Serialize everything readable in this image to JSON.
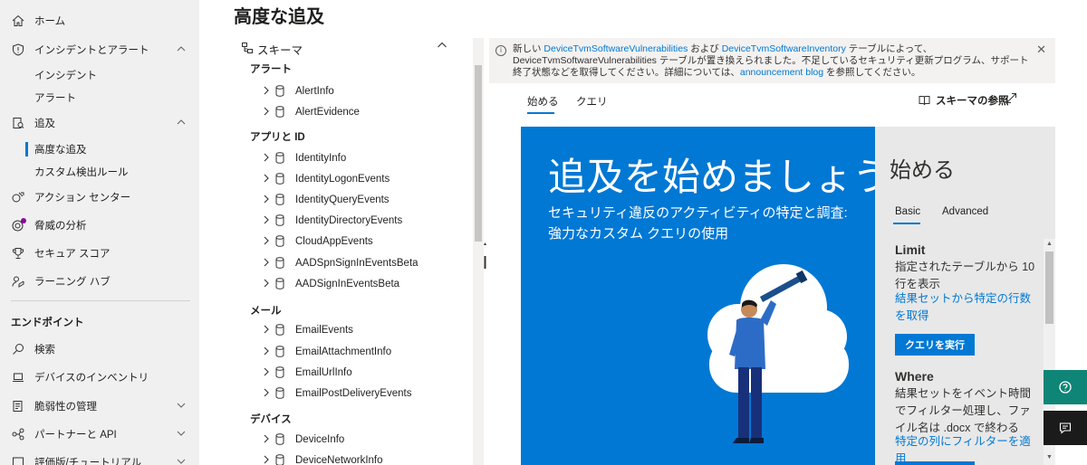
{
  "page": {
    "title": "高度な追及"
  },
  "nav": {
    "items": [
      {
        "label": "ホーム",
        "icon": "home-icon",
        "expanded": null
      },
      {
        "label": "インシデントとアラート",
        "icon": "shield-icon",
        "expanded": true
      },
      {
        "label": "インシデント",
        "sub": true
      },
      {
        "label": "アラート",
        "sub": true
      },
      {
        "label": "追及",
        "icon": "hunting-icon",
        "expanded": true
      },
      {
        "label": "高度な追及",
        "sub": true,
        "active": true
      },
      {
        "label": "カスタム検出ルール",
        "sub": true
      },
      {
        "label": "アクション センター",
        "icon": "action-center-icon"
      },
      {
        "label": "脅威の分析",
        "icon": "threat-analytics-icon"
      },
      {
        "label": "セキュア スコア",
        "icon": "trophy-icon"
      },
      {
        "label": "ラーニング ハブ",
        "icon": "learning-hub-icon"
      }
    ],
    "section_label": "エンドポイント",
    "endpoint_items": [
      {
        "label": "検索",
        "icon": "search-icon"
      },
      {
        "label": "デバイスのインベントリ",
        "icon": "laptop-icon"
      },
      {
        "label": "脆弱性の管理",
        "icon": "vulnerability-icon",
        "expanded": false
      },
      {
        "label": "パートナーと API",
        "icon": "partners-icon",
        "expanded": false
      },
      {
        "label": "評価版/チュートリアル",
        "icon": "tutorial-icon",
        "expanded": false
      }
    ]
  },
  "schema": {
    "title": "スキーマ",
    "groups": [
      {
        "label": "アラート",
        "tables": [
          "AlertInfo",
          "AlertEvidence"
        ]
      },
      {
        "label": "アプリと ID",
        "tables": [
          "IdentityInfo",
          "IdentityLogonEvents",
          "IdentityQueryEvents",
          "IdentityDirectoryEvents",
          "CloudAppEvents",
          "AADSpnSignInEventsBeta",
          "AADSignInEventsBeta"
        ]
      },
      {
        "label": "メール",
        "tables": [
          "EmailEvents",
          "EmailAttachmentInfo",
          "EmailUrlInfo",
          "EmailPostDeliveryEvents"
        ]
      },
      {
        "label": "デバイス",
        "tables": [
          "DeviceInfo",
          "DeviceNetworkInfo"
        ]
      }
    ]
  },
  "info_bar": {
    "t1": "新しい ",
    "link1": "DeviceTvmSoftwareVulnerabilities",
    "t2": " および ",
    "link2": "DeviceTvmSoftwareInventory",
    "t3": " テーブルによって、DeviceTvmSoftwareVulnerabilities テーブルが置き換えられました。不足しているセキュリティ更新プログラム、サポート終了状態などを取得してください。詳細については、",
    "link3": "announcement blog",
    "t4": " を参照してください。",
    "close": "✕"
  },
  "tabs": {
    "items": [
      "始める",
      "クエリ"
    ],
    "schema_reference": "スキーマの参照"
  },
  "hero": {
    "title": "追及を始めましょう",
    "subtitle": "セキュリティ違反のアクティビティの特定と調査: 強力なカスタム クエリの使用"
  },
  "guide": {
    "title": "始める",
    "tabs": [
      "Basic",
      "Advanced"
    ],
    "limit": {
      "heading": "Limit",
      "text": "指定されたテーブルから 10 行を表示",
      "link": "結果セットから特定の行数を取得",
      "button": "クエリを実行"
    },
    "where": {
      "heading": "Where",
      "text": "結果セットをイベント時間でフィルター処理し、ファイル名は .docx で終わる",
      "link": "特定の列にフィルターを適用"
    }
  },
  "colors": {
    "accent": "#0078d4",
    "help_fab": "#0e8577",
    "nav_bg": "#f0f0f0"
  }
}
